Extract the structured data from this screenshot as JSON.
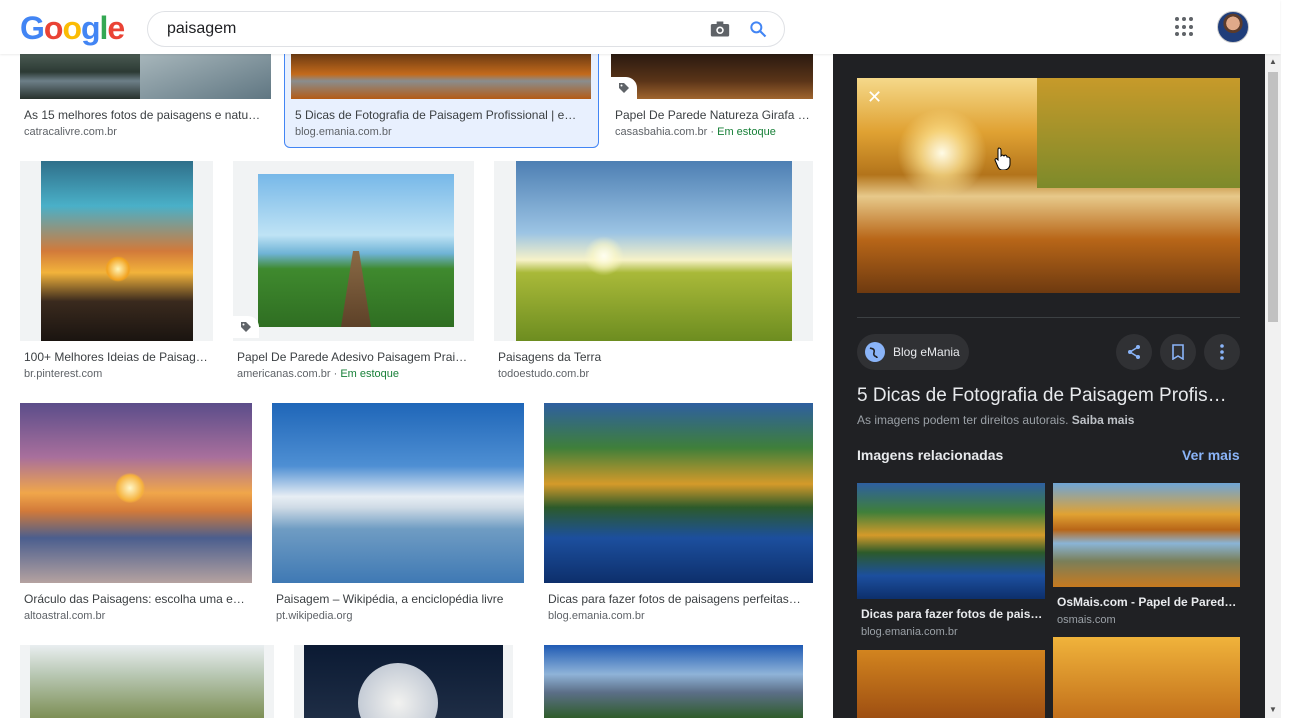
{
  "header": {
    "search_query": "paisagem"
  },
  "results": [
    {
      "caption": "As 15 melhores fotos de paisagens e natu…",
      "source": "catracalivre.com.br",
      "stock": ""
    },
    {
      "caption": "5 Dicas de Fotografia de Paisagem Profissional | e…",
      "source": "blog.emania.com.br",
      "stock": ""
    },
    {
      "caption": "Papel De Parede Natureza Girafa …",
      "source": "casasbahia.com.br · ",
      "stock": "Em estoque"
    },
    {
      "caption": "100+ Melhores Ideias de Paisag…",
      "source": "br.pinterest.com",
      "stock": ""
    },
    {
      "caption": "Papel De Parede Adesivo Paisagem Prai…",
      "source": "americanas.com.br · ",
      "stock": "Em estoque"
    },
    {
      "caption": "Paisagens da Terra",
      "source": "todoestudo.com.br",
      "stock": ""
    },
    {
      "caption": "Oráculo das Paisagens: escolha uma e…",
      "source": "altoastral.com.br",
      "stock": ""
    },
    {
      "caption": "Paisagem – Wikipédia, a enciclopédia livre",
      "source": "pt.wikipedia.org",
      "stock": ""
    },
    {
      "caption": "Dicas para fazer fotos de paisagens perfeitas…",
      "source": "blog.emania.com.br",
      "stock": ""
    }
  ],
  "panel": {
    "site_chip": "Blog eMania",
    "title": "5 Dicas de Fotografia de Paisagem Profis…",
    "copyright": "As imagens podem ter direitos autorais.",
    "learn_more": "Saiba mais",
    "related_heading": "Imagens relacionadas",
    "see_more": "Ver mais",
    "related": [
      {
        "caption": "Dicas para fazer fotos de paisa…",
        "source": "blog.emania.com.br"
      },
      {
        "caption": "OsMais.com - Papel de Parede…",
        "source": "osmais.com"
      }
    ]
  }
}
